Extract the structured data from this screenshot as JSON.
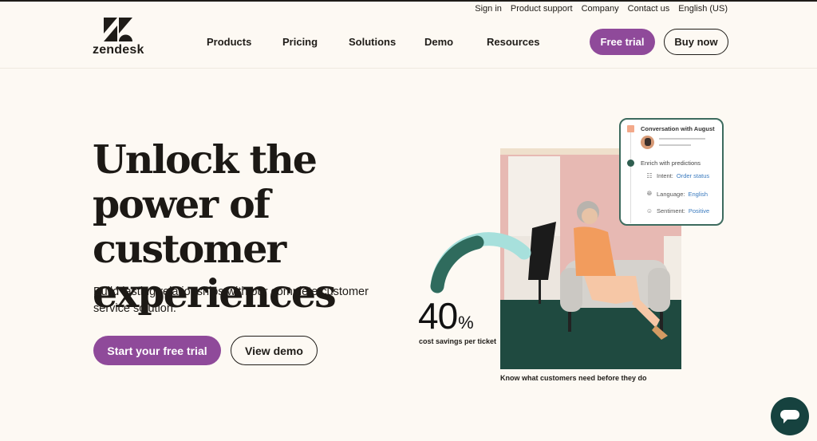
{
  "utility_nav": [
    "Sign in",
    "Product support",
    "Company",
    "Contact us",
    "English (US)"
  ],
  "logo": {
    "text": "zendesk",
    "icon": "zendesk-logo-icon"
  },
  "main_nav": [
    "Products",
    "Pricing",
    "Solutions",
    "Demo",
    "Resources"
  ],
  "header_buttons": {
    "free_trial": "Free trial",
    "buy_now": "Buy now"
  },
  "hero": {
    "title": "Unlock the power of customer experiences",
    "subtitle": "Build lasting relationships with our complete customer service solution.",
    "primary_cta": "Start your free trial",
    "secondary_cta": "View demo"
  },
  "stat": {
    "value": "40",
    "unit": "%",
    "label": "cost savings per ticket"
  },
  "photo_caption": "Know what customers need before they do",
  "card": {
    "title": "Conversation with August",
    "step2": "Enrich with predictions",
    "rows": [
      {
        "icon": "grid-icon",
        "label": "Intent:",
        "value": "Order status"
      },
      {
        "icon": "globe-icon",
        "label": "Language:",
        "value": "English"
      },
      {
        "icon": "smiley-icon",
        "label": "Sentiment:",
        "value": "Positive"
      }
    ]
  },
  "colors": {
    "brand_purple": "#8f4a9a",
    "dark_green": "#16423f",
    "accent_teal": "#a7e0dc",
    "background": "#fdf9f3"
  }
}
